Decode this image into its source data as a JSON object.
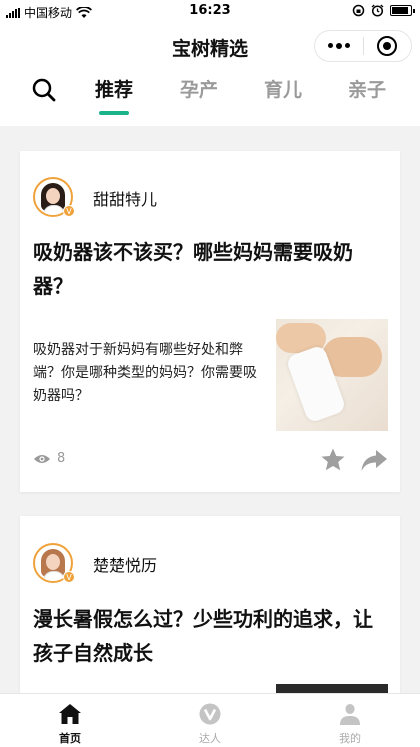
{
  "status_bar": {
    "carrier": "中国移动",
    "time": "16:23"
  },
  "nav": {
    "title": "宝树精选"
  },
  "tabs": [
    {
      "label": "推荐",
      "active": true
    },
    {
      "label": "孕产",
      "active": false
    },
    {
      "label": "育儿",
      "active": false
    },
    {
      "label": "亲子",
      "active": false
    }
  ],
  "feed": [
    {
      "author": "甜甜特儿",
      "title": "吸奶器该不该买？哪些妈妈需要吸奶器？",
      "excerpt": "吸奶器对于新妈妈有哪些好处和弊端？你是哪种类型的妈妈？你需要吸奶器吗？",
      "views": "8"
    },
    {
      "author": "楚楚悦历",
      "title": "漫长暑假怎么过？少些功利的追求，让孩子自然成长"
    }
  ],
  "bottom_nav": [
    {
      "label": "首页",
      "icon": "home-icon",
      "active": true
    },
    {
      "label": "达人",
      "icon": "v-badge-icon",
      "active": false
    },
    {
      "label": "我的",
      "icon": "person-icon",
      "active": false
    }
  ],
  "colors": {
    "accent": "#19b48a",
    "badge": "#f0a23a",
    "inactive": "#9a9a9a"
  }
}
